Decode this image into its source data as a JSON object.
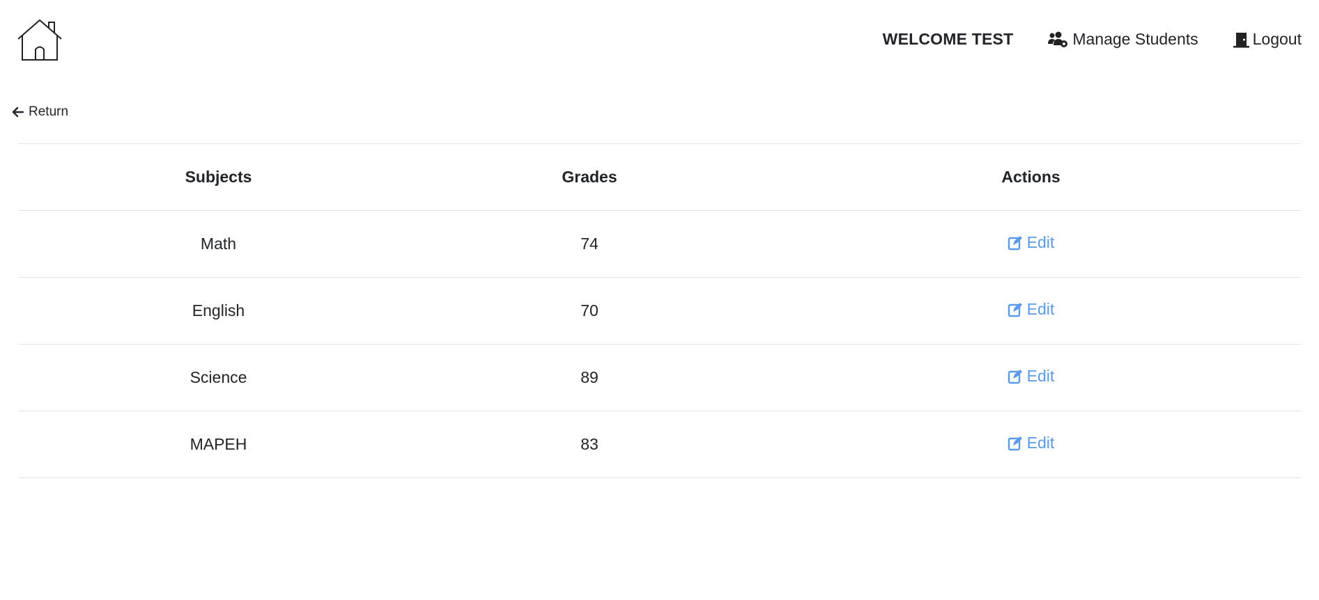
{
  "header": {
    "welcome_text": "WELCOME TEST",
    "manage_students_label": "Manage Students",
    "logout_label": "Logout"
  },
  "return_label": "Return",
  "table": {
    "columns": [
      "Subjects",
      "Grades",
      "Actions"
    ],
    "rows": [
      {
        "subject": "Math",
        "grade": "74",
        "action": "Edit"
      },
      {
        "subject": "English",
        "grade": "70",
        "action": "Edit"
      },
      {
        "subject": "Science",
        "grade": "89",
        "action": "Edit"
      },
      {
        "subject": "MAPEH",
        "grade": "83",
        "action": "Edit"
      }
    ]
  },
  "icons": {
    "logo": "home-icon",
    "manage": "users-gear-icon",
    "logout": "door-icon",
    "return": "arrow-left-icon",
    "edit": "edit-icon"
  },
  "colors": {
    "link_blue": "#5a9ae8",
    "text": "#212529",
    "border": "#dee2e6"
  }
}
